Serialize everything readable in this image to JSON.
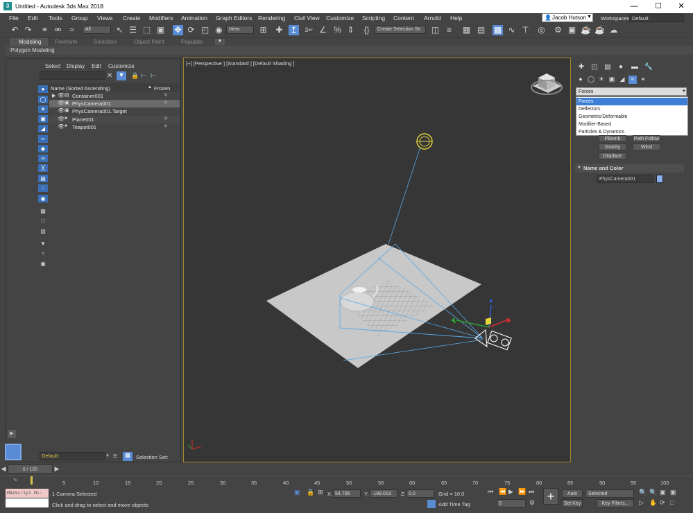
{
  "window": {
    "title": "Untitled - Autodesk 3ds Max 2018",
    "icon_letter": "3"
  },
  "menu": [
    "File",
    "Edit",
    "Tools",
    "Group",
    "Views",
    "Create",
    "Modifiers",
    "Animation",
    "Graph Editors",
    "Rendering",
    "Civil View",
    "Customize",
    "Scripting",
    "Content",
    "Arnold",
    "Help"
  ],
  "user": {
    "name": "Jacob Hutson",
    "workspaces_label": "Workspaces:",
    "workspace": "Default"
  },
  "toolbar": {
    "filter": "All",
    "ref_coord": "View",
    "named_selection": "Create Selection Se"
  },
  "ribbon": {
    "tabs": [
      "Modeling",
      "Freeform",
      "Selection",
      "Object Paint",
      "Populate"
    ],
    "panel": "Polygon Modeling"
  },
  "scene_explorer": {
    "menus": [
      "Select",
      "Display",
      "Edit",
      "Customize"
    ],
    "col_name": "Name (Sorted Ascending)",
    "col_frozen": "Frozen",
    "rows": [
      "Container001",
      "PhysCamera001",
      "PhysCamera001.Target",
      "Plane001",
      "Teapot001"
    ],
    "layer": "Default",
    "selection_set_label": "Selection Set:"
  },
  "viewport": {
    "label": "[+] [Perspective ] [Standard ] [Default Shading ]"
  },
  "command_panel": {
    "category_selected": "Forces",
    "category_options": [
      "Forces",
      "Deflectors",
      "Geometric/Deformable",
      "Modifier-Based",
      "Particles & Dynamics"
    ],
    "object_buttons": [
      "PBomb",
      "Path Follow",
      "Gravity",
      "Wind",
      "Displace"
    ],
    "name_color_rollout": "Name and Color",
    "object_name": "PhysCamera001",
    "object_color": "#8db0ee"
  },
  "timeline": {
    "frame": "0 / 100",
    "ticks": [
      "0",
      "5",
      "10",
      "15",
      "20",
      "25",
      "30",
      "35",
      "40",
      "45",
      "50",
      "55",
      "60",
      "65",
      "70",
      "75",
      "80",
      "85",
      "90",
      "95",
      "100"
    ]
  },
  "status": {
    "maxscript": "MAXScript Mi:",
    "selected": "1 Camera Selected",
    "prompt": "Click and drag to select and move objects",
    "x_label": "X:",
    "x": "54.706",
    "y_label": "Y:",
    "y": "-199.019",
    "z_label": "Z:",
    "z": "0.0",
    "grid": "Grid = 10.0",
    "add_time_tag": "Add Time Tag",
    "frame": "0",
    "auto_key": "Auto Key",
    "set_key": "Set Key",
    "selected_dd": "Selected",
    "key_filters": "Key Filters..."
  },
  "accent_color": "#5a8bd5"
}
